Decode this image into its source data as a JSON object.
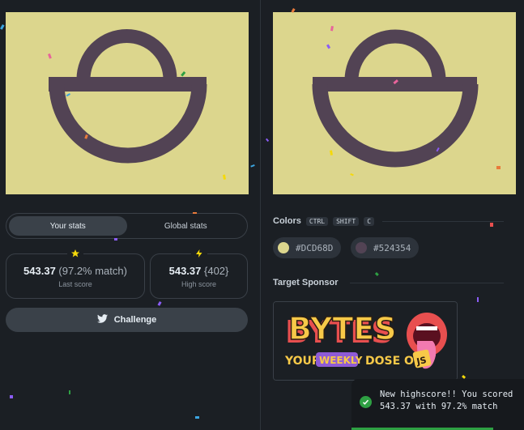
{
  "stats": {
    "tabs": [
      "Your stats",
      "Global stats"
    ],
    "active_tab": "Your stats",
    "last_score": {
      "value": "543.37",
      "detail": "(97.2% match)",
      "label": "Last score",
      "icon": "star-icon"
    },
    "high_score": {
      "value": "543.37",
      "detail": "{402}",
      "label": "High score",
      "icon": "bolt-icon"
    }
  },
  "challenge": {
    "label": "Challenge",
    "icon": "twitter-icon"
  },
  "colors": {
    "heading": "Colors",
    "shortcut_keys": [
      "CTRL",
      "SHIFT",
      "C"
    ],
    "swatches": [
      {
        "hex_label": "#DCD68D",
        "color": "#dcd68d"
      },
      {
        "hex_label": "#524354",
        "color": "#524354"
      }
    ]
  },
  "sponsor": {
    "heading": "Target Sponsor",
    "logo_text": "BYTES",
    "tagline_prefix": "YOUR",
    "tagline_highlight": "WEEKLY",
    "tagline_suffix": "DOSE OF",
    "badge": "JS"
  },
  "toast": {
    "message": "New highscore!! You scored 543.37 with 97.2% match",
    "icon": "check-icon",
    "progress": 0.82
  },
  "theme": {
    "background": "#1b1f24",
    "canvas": "#dcd68d",
    "shape": "#524354",
    "accent_green": "#2ea043"
  }
}
